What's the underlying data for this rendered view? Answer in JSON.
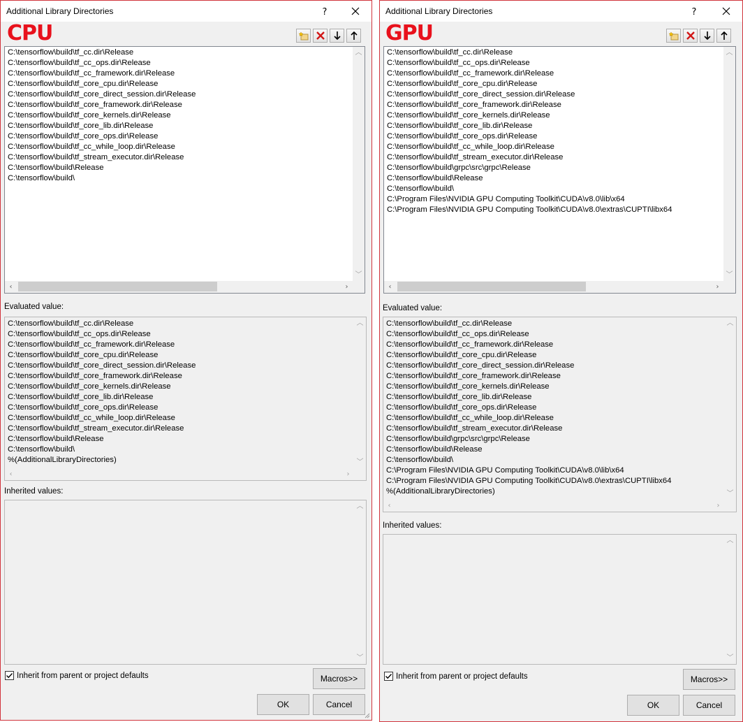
{
  "cpu": {
    "title": "Additional Library Directories",
    "help_glyph": "?",
    "overlay_label": "CPU",
    "toolbar": [
      "new-line-icon",
      "delete-icon",
      "move-down-icon",
      "move-up-icon"
    ],
    "edit_lines": [
      "C:\\tensorflow\\build\\tf_cc.dir\\Release",
      "C:\\tensorflow\\build\\tf_cc_ops.dir\\Release",
      "C:\\tensorflow\\build\\tf_cc_framework.dir\\Release",
      "C:\\tensorflow\\build\\tf_core_cpu.dir\\Release",
      "C:\\tensorflow\\build\\tf_core_direct_session.dir\\Release",
      "C:\\tensorflow\\build\\tf_core_framework.dir\\Release",
      "C:\\tensorflow\\build\\tf_core_kernels.dir\\Release",
      "C:\\tensorflow\\build\\tf_core_lib.dir\\Release",
      "C:\\tensorflow\\build\\tf_core_ops.dir\\Release",
      "C:\\tensorflow\\build\\tf_cc_while_loop.dir\\Release",
      "C:\\tensorflow\\build\\tf_stream_executor.dir\\Release",
      "C:\\tensorflow\\build\\Release",
      "C:\\tensorflow\\build\\"
    ],
    "evaluated_label": "Evaluated value:",
    "evaluated_lines": [
      "C:\\tensorflow\\build\\tf_cc.dir\\Release",
      "C:\\tensorflow\\build\\tf_cc_ops.dir\\Release",
      "C:\\tensorflow\\build\\tf_cc_framework.dir\\Release",
      "C:\\tensorflow\\build\\tf_core_cpu.dir\\Release",
      "C:\\tensorflow\\build\\tf_core_direct_session.dir\\Release",
      "C:\\tensorflow\\build\\tf_core_framework.dir\\Release",
      "C:\\tensorflow\\build\\tf_core_kernels.dir\\Release",
      "C:\\tensorflow\\build\\tf_core_lib.dir\\Release",
      "C:\\tensorflow\\build\\tf_core_ops.dir\\Release",
      "C:\\tensorflow\\build\\tf_cc_while_loop.dir\\Release",
      "C:\\tensorflow\\build\\tf_stream_executor.dir\\Release",
      "C:\\tensorflow\\build\\Release",
      "C:\\tensorflow\\build\\",
      "%(AdditionalLibraryDirectories)"
    ],
    "inherited_label": "Inherited values:",
    "inherited_lines": [],
    "inherit_checkbox_label": "Inherit from parent or project defaults",
    "inherit_checked": true,
    "macros_label": "Macros>>",
    "ok_label": "OK",
    "cancel_label": "Cancel"
  },
  "gpu": {
    "title": "Additional Library Directories",
    "help_glyph": "?",
    "overlay_label": "GPU",
    "toolbar": [
      "new-line-icon",
      "delete-icon",
      "move-down-icon",
      "move-up-icon"
    ],
    "edit_lines": [
      "C:\\tensorflow\\build\\tf_cc.dir\\Release",
      "C:\\tensorflow\\build\\tf_cc_ops.dir\\Release",
      "C:\\tensorflow\\build\\tf_cc_framework.dir\\Release",
      "C:\\tensorflow\\build\\tf_core_cpu.dir\\Release",
      "C:\\tensorflow\\build\\tf_core_direct_session.dir\\Release",
      "C:\\tensorflow\\build\\tf_core_framework.dir\\Release",
      "C:\\tensorflow\\build\\tf_core_kernels.dir\\Release",
      "C:\\tensorflow\\build\\tf_core_lib.dir\\Release",
      "C:\\tensorflow\\build\\tf_core_ops.dir\\Release",
      "C:\\tensorflow\\build\\tf_cc_while_loop.dir\\Release",
      "C:\\tensorflow\\build\\tf_stream_executor.dir\\Release",
      "C:\\tensorflow\\build\\grpc\\src\\grpc\\Release",
      "C:\\tensorflow\\build\\Release",
      "C:\\tensorflow\\build\\",
      "C:\\Program Files\\NVIDIA GPU Computing Toolkit\\CUDA\\v8.0\\lib\\x64",
      "C:\\Program Files\\NVIDIA GPU Computing Toolkit\\CUDA\\v8.0\\extras\\CUPTI\\libx64"
    ],
    "evaluated_label": "Evaluated value:",
    "evaluated_lines": [
      "C:\\tensorflow\\build\\tf_cc.dir\\Release",
      "C:\\tensorflow\\build\\tf_cc_ops.dir\\Release",
      "C:\\tensorflow\\build\\tf_cc_framework.dir\\Release",
      "C:\\tensorflow\\build\\tf_core_cpu.dir\\Release",
      "C:\\tensorflow\\build\\tf_core_direct_session.dir\\Release",
      "C:\\tensorflow\\build\\tf_core_framework.dir\\Release",
      "C:\\tensorflow\\build\\tf_core_kernels.dir\\Release",
      "C:\\tensorflow\\build\\tf_core_lib.dir\\Release",
      "C:\\tensorflow\\build\\tf_core_ops.dir\\Release",
      "C:\\tensorflow\\build\\tf_cc_while_loop.dir\\Release",
      "C:\\tensorflow\\build\\tf_stream_executor.dir\\Release",
      "C:\\tensorflow\\build\\grpc\\src\\grpc\\Release",
      "C:\\tensorflow\\build\\Release",
      "C:\\tensorflow\\build\\",
      "C:\\Program Files\\NVIDIA GPU Computing Toolkit\\CUDA\\v8.0\\lib\\x64",
      "C:\\Program Files\\NVIDIA GPU Computing Toolkit\\CUDA\\v8.0\\extras\\CUPTI\\libx64",
      "%(AdditionalLibraryDirectories)"
    ],
    "inherited_label": "Inherited values:",
    "inherited_lines": [],
    "inherit_checkbox_label": "Inherit from parent or project defaults",
    "inherit_checked": true,
    "macros_label": "Macros>>",
    "ok_label": "OK",
    "cancel_label": "Cancel"
  },
  "colors": {
    "overlay_red": "#e8111c",
    "window_border": "#d1343c",
    "dialog_bg": "#f0f0f0"
  }
}
